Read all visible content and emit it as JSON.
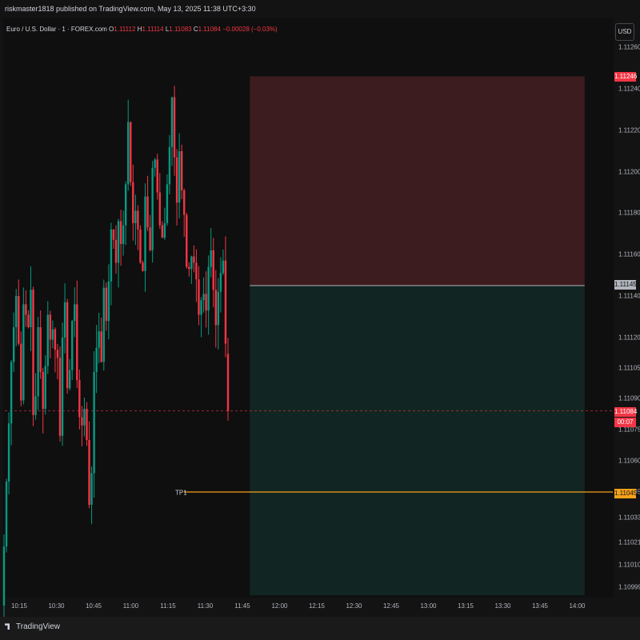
{
  "header": {
    "attribution": "riskmaster1818 published on TradingView.com, May 13, 2025 11:38 UTC+3:30"
  },
  "legend": {
    "symbol": "Euro / U.S. Dollar · 1 · FOREX.com",
    "open_label": "O",
    "open": "1.11112",
    "high_label": "H",
    "high": "1.11114",
    "low_label": "L",
    "low": "1.11083",
    "close_label": "C",
    "close": "1.11084",
    "change": "−0.00028 (−0.03%)"
  },
  "currency_button": "USD",
  "footer": {
    "brand": "TradingView"
  },
  "colors": {
    "up": "#089981",
    "down": "#f23645",
    "stop_zone": "#3c1c1f",
    "target_zone": "#112622",
    "tp_line": "#f7a21b",
    "entry_line": "#b2b5be"
  },
  "chart_data": {
    "type": "candlestick",
    "instrument": "Euro / U.S. Dollar",
    "timeframe": "1",
    "x_tick_labels": [
      "10:15",
      "10:30",
      "10:45",
      "11:00",
      "11:15",
      "11:30",
      "11:45",
      "12:00",
      "12:15",
      "12:30",
      "12:45",
      "13:00",
      "13:15",
      "13:30",
      "13:45",
      "14:00"
    ],
    "y_tick_labels": [
      "1.11260",
      "1.11240",
      "1.11220",
      "1.11200",
      "1.11180",
      "1.11160",
      "1.11140",
      "1.11120",
      "1.11105",
      "1.11090",
      "1.11075",
      "1.11060",
      "1.11045",
      "1.11033",
      "1.11021",
      "1.11010",
      "1.10999"
    ],
    "y_ticks": [
      1.1126,
      1.1124,
      1.1122,
      1.112,
      1.1118,
      1.1116,
      1.1114,
      1.1112,
      1.11105,
      1.1109,
      1.11075,
      1.1106,
      1.11045,
      1.11033,
      1.11021,
      1.1101,
      1.10999
    ],
    "price_tags": {
      "stop": "1.11246",
      "entry": "1.11145",
      "last": "1.11084",
      "countdown": "00:07",
      "take_profit": "1.11045"
    },
    "take_profit_label": "TP1",
    "position": {
      "start_time": "11:48",
      "end_time": "14:03",
      "entry": 1.11145,
      "stop": 1.11246,
      "target": 1.10995
    },
    "closes": [
      1.11019,
      1.1105,
      1.11078,
      1.11108,
      1.11125,
      1.1114,
      1.11117,
      1.11089,
      1.11136,
      1.11131,
      1.11125,
      1.11143,
      1.11082,
      1.11091,
      1.11125,
      1.11103,
      1.11085,
      1.11106,
      1.11131,
      1.11119,
      1.11124,
      1.11114,
      1.1111,
      1.11072,
      1.1112,
      1.11137,
      1.11095,
      1.11104,
      1.11128,
      1.11136,
      1.11099,
      1.11081,
      1.11077,
      1.11085,
      1.1107,
      1.11039,
      1.11054,
      1.11103,
      1.11115,
      1.11123,
      1.11108,
      1.11144,
      1.11128,
      1.11147,
      1.11172,
      1.11167,
      1.11156,
      1.11176,
      1.11165,
      1.11174,
      1.11194,
      1.11224,
      1.11195,
      1.11175,
      1.11181,
      1.11172,
      1.11156,
      1.11152,
      1.11188,
      1.11173,
      1.11162,
      1.11202,
      1.11206,
      1.1119,
      1.11174,
      1.11168,
      1.11175,
      1.11194,
      1.11212,
      1.11236,
      1.11207,
      1.11185,
      1.1121,
      1.11191,
      1.11179,
      1.11154,
      1.11153,
      1.11159,
      1.11156,
      1.11148,
      1.11131,
      1.11138,
      1.11141,
      1.11133,
      1.11154,
      1.11162,
      1.11143,
      1.11126,
      1.11142,
      1.11151,
      1.11157,
      1.11117,
      1.11084
    ],
    "opens": [
      1.1099,
      1.11019,
      1.1105,
      1.11078,
      1.11108,
      1.11125,
      1.1114,
      1.11117,
      1.11089,
      1.11136,
      1.11131,
      1.11125,
      1.11143,
      1.11082,
      1.11091,
      1.11125,
      1.11103,
      1.11085,
      1.11106,
      1.11131,
      1.11119,
      1.11124,
      1.11114,
      1.1111,
      1.11072,
      1.1112,
      1.11137,
      1.11095,
      1.11104,
      1.11128,
      1.11136,
      1.11099,
      1.11081,
      1.11077,
      1.11085,
      1.1107,
      1.11039,
      1.11054,
      1.11103,
      1.11115,
      1.11123,
      1.11108,
      1.11144,
      1.11128,
      1.11147,
      1.11172,
      1.11167,
      1.11156,
      1.11176,
      1.11165,
      1.11174,
      1.11194,
      1.11224,
      1.11195,
      1.11175,
      1.11181,
      1.11172,
      1.11156,
      1.11152,
      1.11188,
      1.11173,
      1.11162,
      1.11202,
      1.11206,
      1.1119,
      1.11174,
      1.11168,
      1.11175,
      1.11194,
      1.11212,
      1.11236,
      1.11207,
      1.11185,
      1.1121,
      1.11191,
      1.11179,
      1.11154,
      1.11153,
      1.11159,
      1.11156,
      1.11148,
      1.11131,
      1.11138,
      1.11141,
      1.11133,
      1.11154,
      1.11162,
      1.11143,
      1.11126,
      1.11142,
      1.11151,
      1.11157,
      1.11112
    ]
  }
}
